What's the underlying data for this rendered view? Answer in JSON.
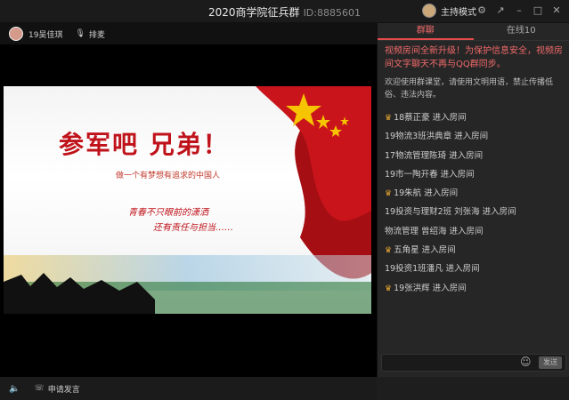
{
  "window": {
    "title": "2020商学院征兵群",
    "id_text": "ID:8885601",
    "host_mode": "主持模式"
  },
  "speaker": {
    "name": "19吴佳琪",
    "mic_label": "排麦"
  },
  "slide": {
    "title": "参军吧 兄弟！",
    "subtitle": "做一个有梦想有追求的中国人",
    "slogan_line1": "青春不只眼前的潇洒",
    "slogan_line2": "还有责任与担当……"
  },
  "bottom": {
    "apply_label": "申请发言"
  },
  "tabs": [
    {
      "label": "群聊"
    },
    {
      "label": "在线10"
    }
  ],
  "chat": {
    "notice": "视频房间全新升级！为保护信息安全，视频房间文字聊天不再与QQ群同步。",
    "welcome": "欢迎使用群课堂，请使用文明用语，禁止传播低俗、违法内容。",
    "messages": [
      {
        "text": "18蔡正豪 进入房间",
        "crown": true
      },
      {
        "text": "19物流3班洪典章 进入房间",
        "crown": false
      },
      {
        "text": "17物流管理陈琦 进入房间",
        "crown": false
      },
      {
        "text": "19市一陶开春 进入房间",
        "crown": false
      },
      {
        "text": "19朱航 进入房间",
        "crown": true
      },
      {
        "text": "19投资与理财2班 刘张海 进入房间",
        "crown": false
      },
      {
        "text": "物流管理 曾绍海 进入房间",
        "crown": false
      },
      {
        "text": "五角星 进入房间",
        "crown": true
      },
      {
        "text": "19投资1班潘凡 进入房间",
        "crown": false
      },
      {
        "text": "19张洪辉 进入房间",
        "crown": true
      }
    ]
  },
  "input": {
    "send_label": "发送"
  }
}
